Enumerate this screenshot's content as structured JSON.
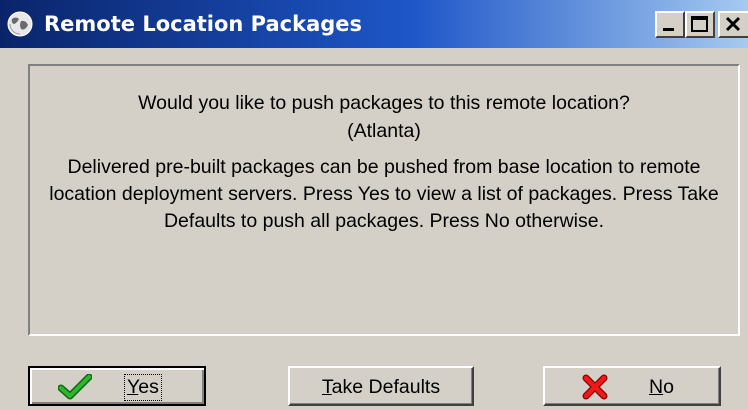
{
  "window": {
    "title": "Remote Location Packages",
    "title_icon": "globe-icon",
    "controls": {
      "minimize": "minimize-icon",
      "maximize": "maximize-icon",
      "close": "close-icon"
    }
  },
  "message": {
    "question": "Would you like to push packages to this remote location?",
    "location": "(Atlanta)",
    "description": "Delivered pre-built packages can be pushed from base location to remote location deployment servers. Press Yes to view a list of packages. Press Take Defaults to push all packages. Press No otherwise."
  },
  "buttons": {
    "yes": {
      "mnemonic": "Y",
      "rest": "es",
      "icon": "check-icon",
      "icon_color": "#1e9a1e",
      "is_default": true
    },
    "take_defaults": {
      "mnemonic": "T",
      "rest": "ake Defaults"
    },
    "no": {
      "mnemonic": "N",
      "rest": "o",
      "icon": "x-cancel-icon",
      "icon_color": "#e01010"
    }
  },
  "colors": {
    "titlebar_start": "#0a246a",
    "titlebar_end": "#a6caf0",
    "face": "#d4d0c8"
  }
}
